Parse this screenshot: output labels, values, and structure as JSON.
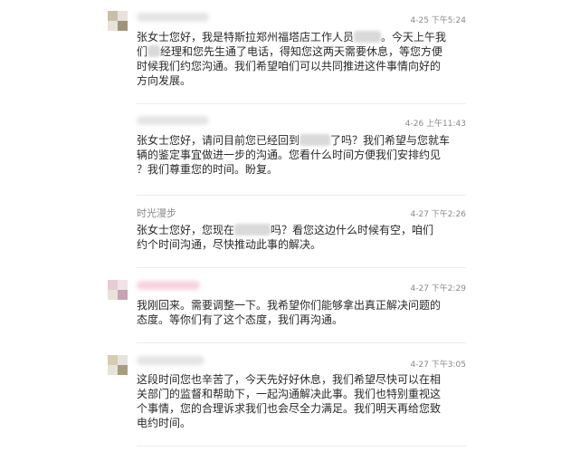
{
  "messages": [
    {
      "name": "",
      "time": "4-25 下午5:24",
      "lines": [
        [
          "张女士您好，我是特斯拉郑州福塔店工作人员",
          "",
          "。今天上午我"
        ],
        [
          "们",
          "",
          "经理和您先生通了电话，得知您这两天需要休息，等您方便"
        ],
        [
          "时候我们约您沟通。我们希望咱们可以共同推进这件事情向好的"
        ],
        [
          "方向发展。"
        ]
      ]
    },
    {
      "name": "",
      "time": "4-26 上午11:43",
      "lines": [
        [
          "张女士您好，请问目前您已经回到",
          "",
          "了吗？我们希望与您就车"
        ],
        [
          "辆的鉴定事宜做进一步的沟通。您看什么时间方便我们安排约见"
        ],
        [
          "？我们尊重您的时间。盼复。"
        ]
      ]
    },
    {
      "name": "时光漫步",
      "time": "4-27 下午2:26",
      "lines": [
        [
          "张女士您好，您现在",
          "",
          "吗？看您这边什么时候有空，咱们"
        ],
        [
          "约个时间沟通，尽快推动此事的解决。"
        ]
      ]
    },
    {
      "name": "",
      "time": "4-27 下午2:29",
      "lines": [
        [
          "我刚回来。需要调整一下。我希望你们能够拿出真正解决问题的"
        ],
        [
          "态度。等你们有了这个态度，我们再沟通。"
        ]
      ]
    },
    {
      "name": "",
      "time": "4-27 下午3:05",
      "lines": [
        [
          "这段时间您也辛苦了，今天先好好休息，我们希望尽快可以在相"
        ],
        [
          "关部门的监督和帮助下，一起沟通解决此事。我们也特别重视这"
        ],
        [
          "个事情，您的合理诉求我们也会尽全力满足。我们明天再给您致"
        ],
        [
          "电约时间。"
        ]
      ]
    }
  ]
}
